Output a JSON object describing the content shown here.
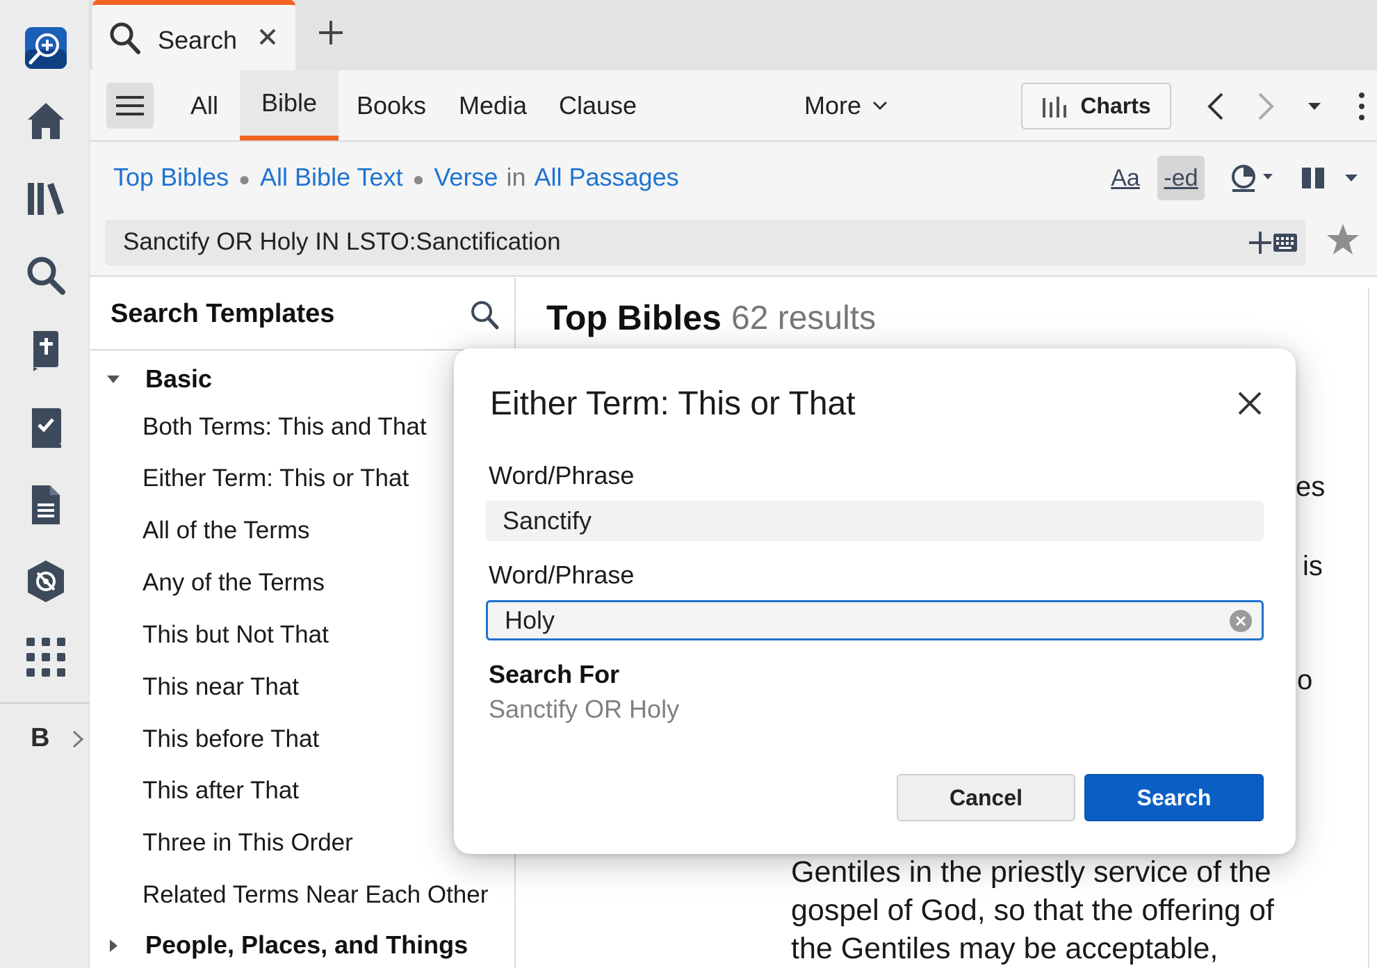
{
  "tab": {
    "label": "Search"
  },
  "search_tabs": [
    {
      "label": "All"
    },
    {
      "label": "Bible"
    },
    {
      "label": "Books"
    },
    {
      "label": "Media"
    },
    {
      "label": "Clause"
    }
  ],
  "active_tab": "Bible",
  "more_label": "More",
  "charts_label": "Charts",
  "scope": {
    "link1": "Top Bibles",
    "link2": "All Bible Text",
    "link3": "Verse",
    "in_word": "in",
    "link4": "All Passages"
  },
  "display_icons": {
    "font": "Aa",
    "inflect": "-ed"
  },
  "query": "Sanctify OR Holy IN LSTO:Sanctification",
  "rail": {
    "bottom_label": "B"
  },
  "templates": {
    "title": "Search Templates",
    "group1": "Basic",
    "items": [
      "Both Terms: This and That",
      "Either Term: This or That",
      "All of the Terms",
      "Any of the Terms",
      "This but Not That",
      "This near That",
      "This before That",
      "This after That",
      "Three in This Order",
      "Related Terms Near Each Other"
    ],
    "group2": "People, Places, and Things"
  },
  "results": {
    "title": "Top Bibles",
    "count": "62 results",
    "fragments": [
      "es",
      "is",
      "o"
    ],
    "verse_lines": [
      "Gentiles in the priestly service of the",
      "gospel of God, so that the offering of",
      "the Gentiles may be acceptable,"
    ]
  },
  "dialog": {
    "title": "Either Term: This or That",
    "label1": "Word/Phrase",
    "value1": "Sanctify",
    "label2": "Word/Phrase",
    "value2": "Holy",
    "search_for_label": "Search For",
    "search_for_value": "Sanctify OR Holy",
    "cancel": "Cancel",
    "search": "Search"
  },
  "colors": {
    "accent": "#f26322",
    "link": "#1e73d0",
    "primary_button": "#0b5fc4",
    "icon": "#3d4a5c"
  }
}
